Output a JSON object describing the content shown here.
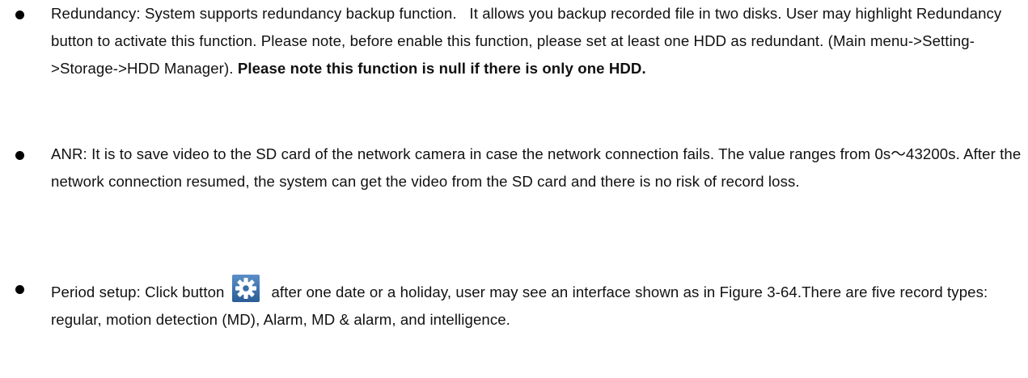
{
  "bullets": [
    {
      "paragraph": "Redundancy: System supports redundancy backup function.   It allows you backup recorded file in two disks. User may highlight Redundancy button to activate this function. Please note, before enable this function, please set at least one HDD as redundant. (Main menu->Setting->Storage->HDD Manager).",
      "bold_note": "Please note this function is null if there is only one HDD."
    },
    {
      "paragraph": "ANR: It is to save video to the SD card of the network camera in case the network connection fails. The value ranges from 0s～43200s. After the network connection resumed, the system can get the video from the SD card and there is no risk of record loss."
    },
    {
      "before_icon": "Period setup: Click button",
      "icon": "gear-icon",
      "after_icon": "after one date or a holiday, user may see an interface shown as in Figure 3-64.There are five record types: regular, motion detection (MD), Alarm, MD & alarm, and intelligence."
    }
  ],
  "colors": {
    "text": "#111111",
    "bullet": "#000000",
    "icon_bg": "#3a6ea8",
    "icon_gear": "#ffffff"
  }
}
